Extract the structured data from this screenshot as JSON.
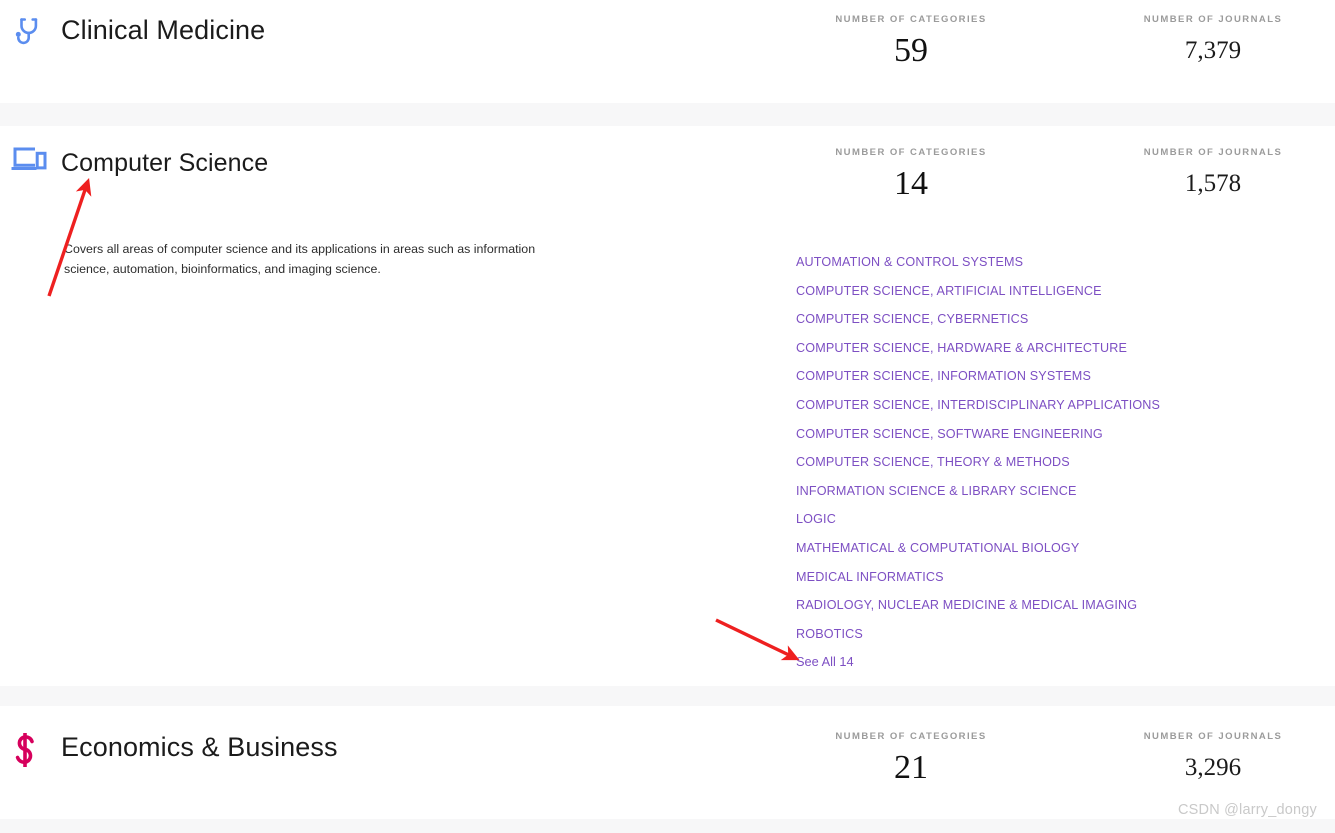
{
  "page": {
    "watermark": "CSDN @larry_dongy",
    "stat_labels": {
      "categories": "NUMBER OF CATEGORIES",
      "journals": "NUMBER OF JOURNALS"
    },
    "colors": {
      "link_purple": "#7d4fc3",
      "icon_blue": "#5b8def",
      "icon_crimson": "#d6005c",
      "annotation_red": "#ee2020",
      "band_gray": "#f7f7f8",
      "stat_label_gray": "#9b9b9b"
    }
  },
  "sections": [
    {
      "id": "clinical-medicine",
      "title": "Clinical Medicine",
      "icon": "stethoscope-icon",
      "icon_color": "#5b8def",
      "categories_count": "59",
      "journals_count": "7,379",
      "description": "",
      "category_links": [],
      "see_all_label": ""
    },
    {
      "id": "computer-science",
      "title": "Computer Science",
      "icon": "monitor-devices-icon",
      "icon_color": "#5b8def",
      "categories_count": "14",
      "journals_count": "1,578",
      "description": "Covers all areas of computer science and its applications in areas such as information science, automation, bioinformatics, and imaging science.",
      "category_links": [
        "AUTOMATION & CONTROL SYSTEMS",
        "COMPUTER SCIENCE, ARTIFICIAL INTELLIGENCE",
        "COMPUTER SCIENCE, CYBERNETICS",
        "COMPUTER SCIENCE, HARDWARE & ARCHITECTURE",
        "COMPUTER SCIENCE, INFORMATION SYSTEMS",
        "COMPUTER SCIENCE, INTERDISCIPLINARY APPLICATIONS",
        "COMPUTER SCIENCE, SOFTWARE ENGINEERING",
        "COMPUTER SCIENCE, THEORY & METHODS",
        "INFORMATION SCIENCE & LIBRARY SCIENCE",
        "LOGIC",
        "MATHEMATICAL & COMPUTATIONAL BIOLOGY",
        "MEDICAL INFORMATICS",
        "RADIOLOGY, NUCLEAR MEDICINE & MEDICAL IMAGING",
        "ROBOTICS"
      ],
      "see_all_label": "See All 14"
    },
    {
      "id": "economics-business",
      "title": "Economics & Business",
      "icon": "dollar-sign-icon",
      "icon_color": "#d6005c",
      "categories_count": "21",
      "journals_count": "3,296",
      "description": "",
      "category_links": [],
      "see_all_label": ""
    }
  ],
  "annotations": [
    {
      "name": "arrow-pointing-to-computer-science-title",
      "color": "#ee2020"
    },
    {
      "name": "arrow-pointing-to-see-all-link",
      "color": "#ee2020"
    }
  ]
}
